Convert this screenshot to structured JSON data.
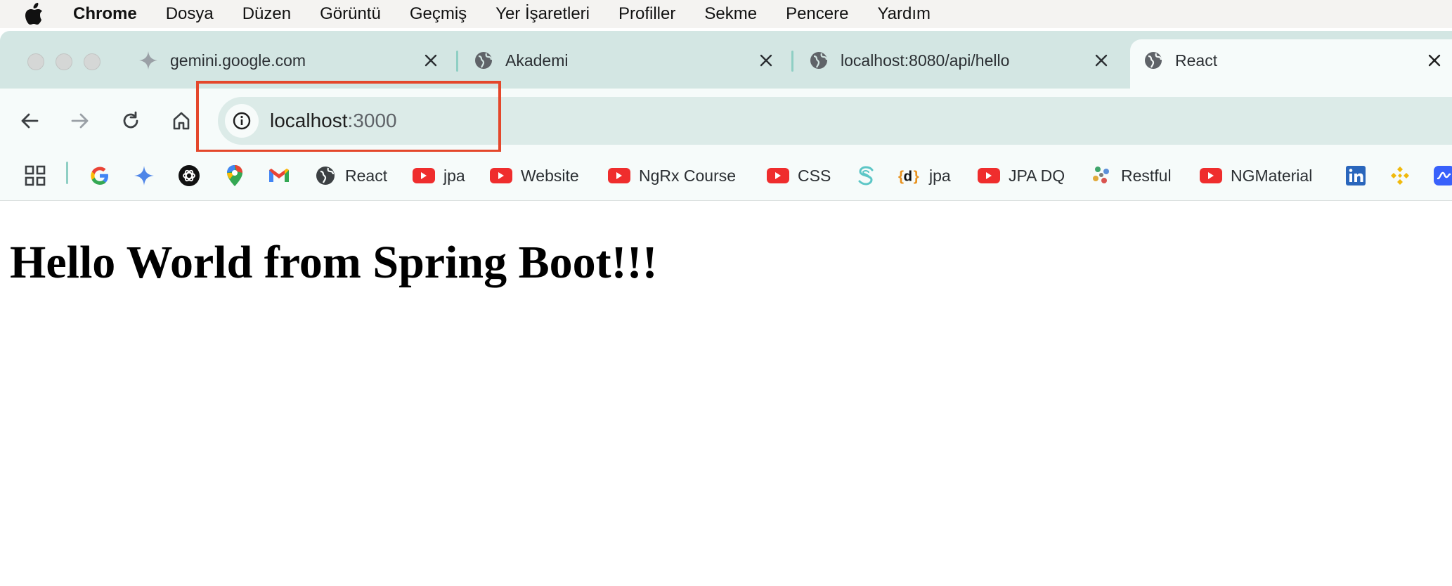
{
  "menubar": {
    "app_name": "Chrome",
    "items": [
      "Dosya",
      "Düzen",
      "Görüntü",
      "Geçmiş",
      "Yer İşaretleri",
      "Profiller",
      "Sekme",
      "Pencere",
      "Yardım"
    ]
  },
  "tabs": [
    {
      "title": "gemini.google.com",
      "icon": "gemini-sparkle-icon",
      "active": false
    },
    {
      "title": "Akademi",
      "icon": "globe-icon",
      "active": false
    },
    {
      "title": "localhost:8080/api/hello",
      "icon": "globe-icon",
      "active": false
    },
    {
      "title": "React",
      "icon": "globe-icon",
      "active": true
    }
  ],
  "address_bar": {
    "host": "localhost",
    "port": ":3000",
    "icon": "info-icon"
  },
  "bookmarks": [
    {
      "label": "",
      "icon": "apps-grid-icon"
    },
    {
      "label": "",
      "icon": "google-icon"
    },
    {
      "label": "",
      "icon": "gemini-icon"
    },
    {
      "label": "",
      "icon": "chatgpt-icon"
    },
    {
      "label": "",
      "icon": "maps-pin-icon"
    },
    {
      "label": "",
      "icon": "gmail-icon"
    },
    {
      "label": "React",
      "icon": "globe-icon"
    },
    {
      "label": "jpa",
      "icon": "youtube-icon"
    },
    {
      "label": "Website",
      "icon": "youtube-icon"
    },
    {
      "label": "NgRx Course",
      "icon": "youtube-icon"
    },
    {
      "label": "CSS",
      "icon": "youtube-icon"
    },
    {
      "label": "",
      "icon": "s-logo-icon"
    },
    {
      "label": "jpa",
      "icon": "dev-d-icon"
    },
    {
      "label": "JPA DQ",
      "icon": "youtube-icon"
    },
    {
      "label": "Restful",
      "icon": "slack-like-icon"
    },
    {
      "label": "NGMaterial",
      "icon": "youtube-icon"
    },
    {
      "label": "",
      "icon": "linkedin-icon"
    },
    {
      "label": "",
      "icon": "binance-icon"
    },
    {
      "label": "",
      "icon": "coinmarketcap-icon"
    }
  ],
  "page": {
    "heading": "Hello World from Spring Boot!!!"
  },
  "colors": {
    "tab_strip": "#d3e6e3",
    "toolbar": "#f6fbfa",
    "omnibox": "#dcebe8",
    "highlight": "#e4472b",
    "youtube_red": "#ef2d2d"
  }
}
